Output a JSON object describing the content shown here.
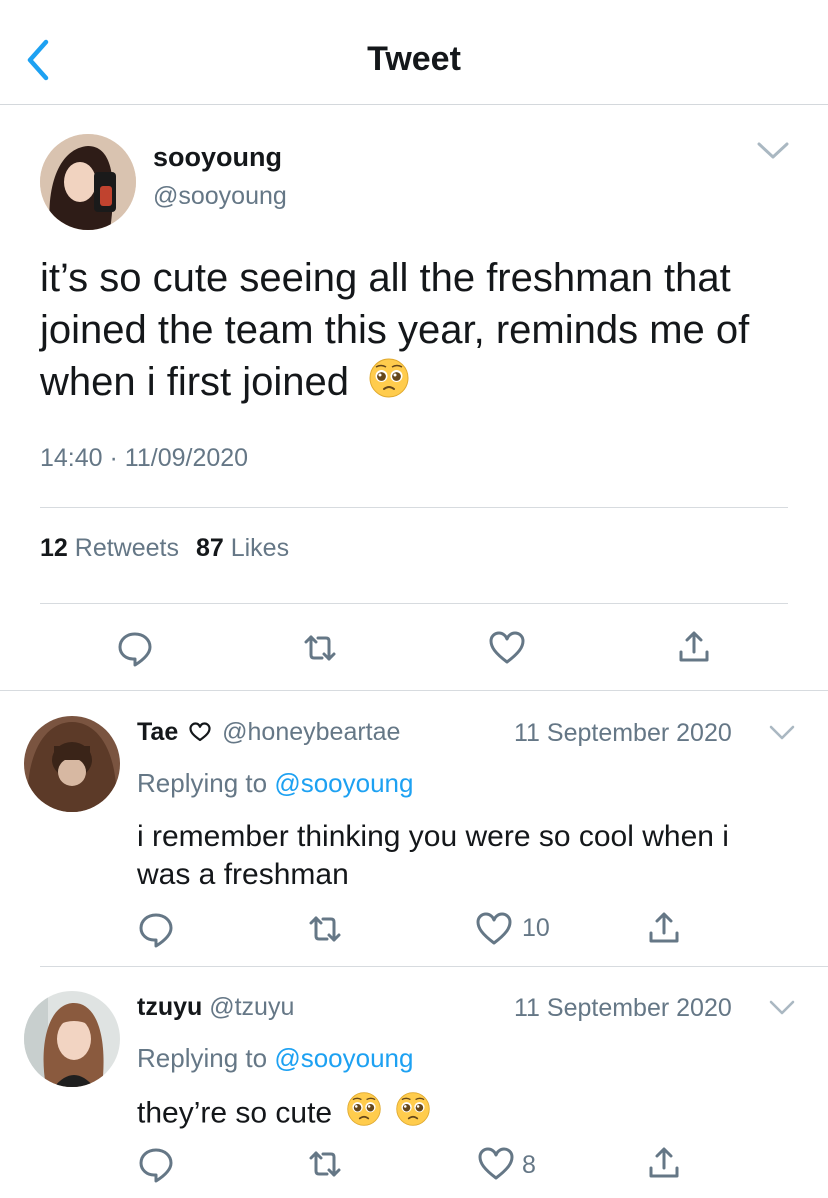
{
  "header": {
    "title": "Tweet"
  },
  "main_tweet": {
    "display_name": "sooyoung",
    "handle": "@sooyoung",
    "text_line1": "it’s so cute seeing all the freshman that",
    "text_line2": "joined the team this year, reminds me of",
    "text_line3": "when i first joined",
    "emoji": "pleading-face",
    "time": "14:40",
    "dot": "·",
    "date": "11/09/2020",
    "retweets_count": "12",
    "retweets_label": "Retweets",
    "likes_count": "87",
    "likes_label": "Likes"
  },
  "replies": [
    {
      "display_name": "Tae",
      "handle": "@honeybeartae",
      "date": "11 September 2020",
      "replying_prefix": "Replying to",
      "replying_handle": "@sooyoung",
      "text_line1": "i remember thinking you were so cool when i",
      "text_line2": "was a freshman",
      "like_count": "10"
    },
    {
      "display_name": "tzuyu",
      "handle": "@tzuyu",
      "date": "11 September 2020",
      "replying_prefix": "Replying to",
      "replying_handle": "@sooyoung",
      "text_line1": "they’re so cute",
      "like_count": "8"
    }
  ],
  "colors": {
    "accent": "#1da1f2",
    "secondary_text": "#657786",
    "divider": "#d7dbdf"
  },
  "icons": [
    "back-chevron-icon",
    "reply-icon",
    "retweet-icon",
    "like-icon",
    "share-icon",
    "chevron-down-icon",
    "heart-outline-icon"
  ]
}
